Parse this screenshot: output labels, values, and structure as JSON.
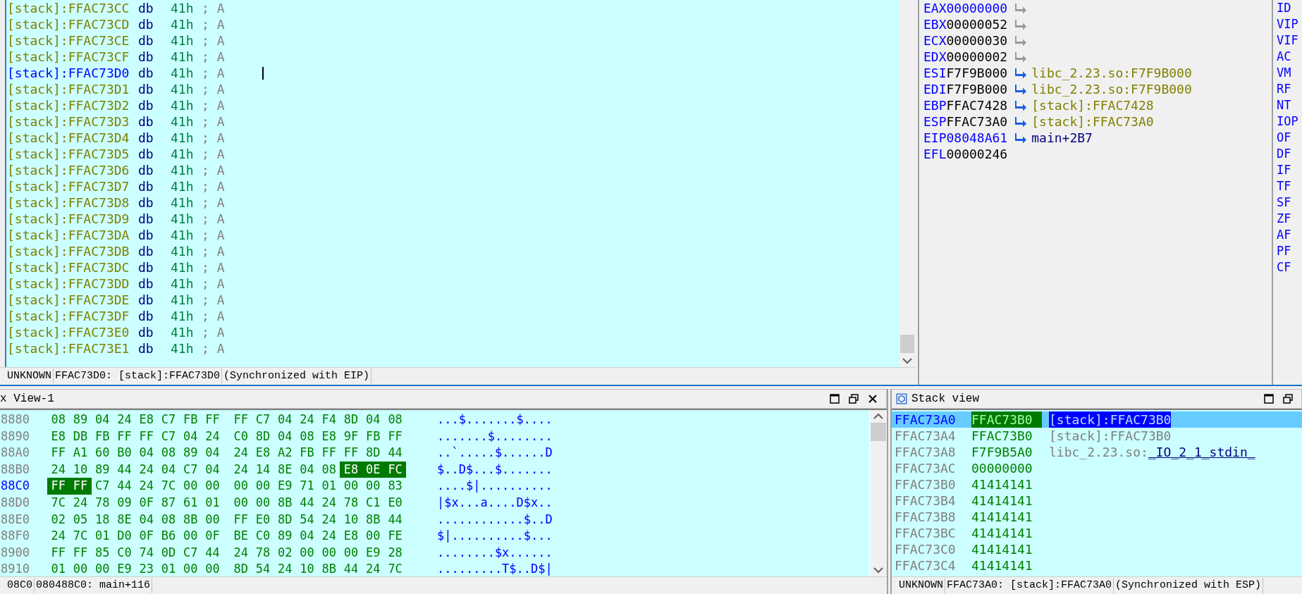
{
  "listing": {
    "rows": [
      {
        "address": "[stack]:FFAC73CC",
        "mnemonic": "db",
        "operand": "41h",
        "comment": "; A",
        "current": false
      },
      {
        "address": "[stack]:FFAC73CD",
        "mnemonic": "db",
        "operand": "41h",
        "comment": "; A",
        "current": false
      },
      {
        "address": "[stack]:FFAC73CE",
        "mnemonic": "db",
        "operand": "41h",
        "comment": "; A",
        "current": false
      },
      {
        "address": "[stack]:FFAC73CF",
        "mnemonic": "db",
        "operand": "41h",
        "comment": "; A",
        "current": false
      },
      {
        "address": "[stack]:FFAC73D0",
        "mnemonic": "db",
        "operand": "41h",
        "comment": "; A",
        "current": true
      },
      {
        "address": "[stack]:FFAC73D1",
        "mnemonic": "db",
        "operand": "41h",
        "comment": "; A",
        "current": false
      },
      {
        "address": "[stack]:FFAC73D2",
        "mnemonic": "db",
        "operand": "41h",
        "comment": "; A",
        "current": false
      },
      {
        "address": "[stack]:FFAC73D3",
        "mnemonic": "db",
        "operand": "41h",
        "comment": "; A",
        "current": false
      },
      {
        "address": "[stack]:FFAC73D4",
        "mnemonic": "db",
        "operand": "41h",
        "comment": "; A",
        "current": false
      },
      {
        "address": "[stack]:FFAC73D5",
        "mnemonic": "db",
        "operand": "41h",
        "comment": "; A",
        "current": false
      },
      {
        "address": "[stack]:FFAC73D6",
        "mnemonic": "db",
        "operand": "41h",
        "comment": "; A",
        "current": false
      },
      {
        "address": "[stack]:FFAC73D7",
        "mnemonic": "db",
        "operand": "41h",
        "comment": "; A",
        "current": false
      },
      {
        "address": "[stack]:FFAC73D8",
        "mnemonic": "db",
        "operand": "41h",
        "comment": "; A",
        "current": false
      },
      {
        "address": "[stack]:FFAC73D9",
        "mnemonic": "db",
        "operand": "41h",
        "comment": "; A",
        "current": false
      },
      {
        "address": "[stack]:FFAC73DA",
        "mnemonic": "db",
        "operand": "41h",
        "comment": "; A",
        "current": false
      },
      {
        "address": "[stack]:FFAC73DB",
        "mnemonic": "db",
        "operand": "41h",
        "comment": "; A",
        "current": false
      },
      {
        "address": "[stack]:FFAC73DC",
        "mnemonic": "db",
        "operand": "41h",
        "comment": "; A",
        "current": false
      },
      {
        "address": "[stack]:FFAC73DD",
        "mnemonic": "db",
        "operand": "41h",
        "comment": "; A",
        "current": false
      },
      {
        "address": "[stack]:FFAC73DE",
        "mnemonic": "db",
        "operand": "41h",
        "comment": "; A",
        "current": false
      },
      {
        "address": "[stack]:FFAC73DF",
        "mnemonic": "db",
        "operand": "41h",
        "comment": "; A",
        "current": false
      },
      {
        "address": "[stack]:FFAC73E0",
        "mnemonic": "db",
        "operand": "41h",
        "comment": "; A",
        "current": false
      },
      {
        "address": "[stack]:FFAC73E1",
        "mnemonic": "db",
        "operand": "41h",
        "comment": "; A",
        "current": false
      }
    ],
    "status": [
      "UNKNOWN",
      "FFAC73D0: [stack]:FFAC73D0",
      "(Synchronized with EIP)"
    ]
  },
  "registers": [
    {
      "name": "EAX",
      "value": "00000000",
      "changed": true,
      "arrow": true,
      "pointer": false
    },
    {
      "name": "EBX",
      "value": "00000052",
      "changed": false,
      "arrow": true,
      "pointer": false
    },
    {
      "name": "ECX",
      "value": "00000030",
      "changed": false,
      "arrow": true,
      "pointer": false
    },
    {
      "name": "EDX",
      "value": "00000002",
      "changed": false,
      "arrow": true,
      "pointer": false
    },
    {
      "name": "ESI",
      "value": "F7F9B000",
      "changed": false,
      "arrow": true,
      "pointer": true,
      "target": {
        "text": "libc_2.23.so:F7F9B000",
        "kind": "data"
      }
    },
    {
      "name": "EDI",
      "value": "F7F9B000",
      "changed": false,
      "arrow": true,
      "pointer": true,
      "target": {
        "text": "libc_2.23.so:F7F9B000",
        "kind": "data"
      }
    },
    {
      "name": "EBP",
      "value": "FFAC7428",
      "changed": false,
      "arrow": true,
      "pointer": true,
      "target": {
        "text": "[stack]:FFAC7428",
        "kind": "data"
      }
    },
    {
      "name": "ESP",
      "value": "FFAC73A0",
      "changed": false,
      "arrow": true,
      "pointer": true,
      "target": {
        "text": "[stack]:FFAC73A0",
        "kind": "data"
      }
    },
    {
      "name": "EIP",
      "value": "08048A61",
      "changed": true,
      "arrow": true,
      "pointer": true,
      "target": {
        "text": "main+2B7",
        "kind": "code"
      }
    },
    {
      "name": "EFL",
      "value": "00000246",
      "changed": false,
      "arrow": false
    }
  ],
  "flags": [
    "ID",
    "VIP",
    "VIF",
    "AC",
    "VM",
    "RF",
    "NT",
    "IOP",
    "OF",
    "DF",
    "IF",
    "TF",
    "SF",
    "ZF",
    "AF",
    "PF",
    "CF"
  ],
  "hex_view": {
    "title": "x View-1",
    "rows": [
      {
        "address": "8880",
        "current": false,
        "ascii": "...$.......$....",
        "bytes": [
          {
            "byte": "08",
            "selected": false
          },
          {
            "byte": "89",
            "selected": false
          },
          {
            "byte": "04",
            "selected": false
          },
          {
            "byte": "24",
            "selected": false
          },
          {
            "byte": "E8",
            "selected": false
          },
          {
            "byte": "C7",
            "selected": false
          },
          {
            "byte": "FB",
            "selected": false
          },
          {
            "byte": "FF",
            "selected": false
          },
          {
            "byte": "FF",
            "selected": false
          },
          {
            "byte": "C7",
            "selected": false
          },
          {
            "byte": "04",
            "selected": false
          },
          {
            "byte": "24",
            "selected": false
          },
          {
            "byte": "F4",
            "selected": false
          },
          {
            "byte": "8D",
            "selected": false
          },
          {
            "byte": "04",
            "selected": false
          },
          {
            "byte": "08",
            "selected": false
          }
        ]
      },
      {
        "address": "8890",
        "current": false,
        "ascii": ".......$........",
        "bytes": [
          {
            "byte": "E8",
            "selected": false
          },
          {
            "byte": "DB",
            "selected": false
          },
          {
            "byte": "FB",
            "selected": false
          },
          {
            "byte": "FF",
            "selected": false
          },
          {
            "byte": "FF",
            "selected": false
          },
          {
            "byte": "C7",
            "selected": false
          },
          {
            "byte": "04",
            "selected": false
          },
          {
            "byte": "24",
            "selected": false
          },
          {
            "byte": "C0",
            "selected": false
          },
          {
            "byte": "8D",
            "selected": false
          },
          {
            "byte": "04",
            "selected": false
          },
          {
            "byte": "08",
            "selected": false
          },
          {
            "byte": "E8",
            "selected": false
          },
          {
            "byte": "9F",
            "selected": false
          },
          {
            "byte": "FB",
            "selected": false
          },
          {
            "byte": "FF",
            "selected": false
          }
        ]
      },
      {
        "address": "88A0",
        "current": false,
        "ascii": "..`.....$......D",
        "bytes": [
          {
            "byte": "FF",
            "selected": false
          },
          {
            "byte": "A1",
            "selected": false
          },
          {
            "byte": "60",
            "selected": false
          },
          {
            "byte": "B0",
            "selected": false
          },
          {
            "byte": "04",
            "selected": false
          },
          {
            "byte": "08",
            "selected": false
          },
          {
            "byte": "89",
            "selected": false
          },
          {
            "byte": "04",
            "selected": false
          },
          {
            "byte": "24",
            "selected": false
          },
          {
            "byte": "E8",
            "selected": false
          },
          {
            "byte": "A2",
            "selected": false
          },
          {
            "byte": "FB",
            "selected": false
          },
          {
            "byte": "FF",
            "selected": false
          },
          {
            "byte": "FF",
            "selected": false
          },
          {
            "byte": "8D",
            "selected": false
          },
          {
            "byte": "44",
            "selected": false
          }
        ]
      },
      {
        "address": "88B0",
        "current": false,
        "ascii": "$..D$...$.......",
        "bytes": [
          {
            "byte": "24",
            "selected": false
          },
          {
            "byte": "10",
            "selected": false
          },
          {
            "byte": "89",
            "selected": false
          },
          {
            "byte": "44",
            "selected": false
          },
          {
            "byte": "24",
            "selected": false
          },
          {
            "byte": "04",
            "selected": false
          },
          {
            "byte": "C7",
            "selected": false
          },
          {
            "byte": "04",
            "selected": false
          },
          {
            "byte": "24",
            "selected": false
          },
          {
            "byte": "14",
            "selected": false
          },
          {
            "byte": "8E",
            "selected": false
          },
          {
            "byte": "04",
            "selected": false
          },
          {
            "byte": "08",
            "selected": false
          },
          {
            "byte": "E8",
            "selected": true
          },
          {
            "byte": "0E",
            "selected": true
          },
          {
            "byte": "FC",
            "selected": true
          }
        ]
      },
      {
        "address": "88C0",
        "current": true,
        "ascii": "....$|..........",
        "bytes": [
          {
            "byte": "FF",
            "selected": true
          },
          {
            "byte": "FF",
            "selected": true
          },
          {
            "byte": "C7",
            "selected": false
          },
          {
            "byte": "44",
            "selected": false
          },
          {
            "byte": "24",
            "selected": false
          },
          {
            "byte": "7C",
            "selected": false
          },
          {
            "byte": "00",
            "selected": false
          },
          {
            "byte": "00",
            "selected": false
          },
          {
            "byte": "00",
            "selected": false
          },
          {
            "byte": "00",
            "selected": false
          },
          {
            "byte": "E9",
            "selected": false
          },
          {
            "byte": "71",
            "selected": false
          },
          {
            "byte": "01",
            "selected": false
          },
          {
            "byte": "00",
            "selected": false
          },
          {
            "byte": "00",
            "selected": false
          },
          {
            "byte": "83",
            "selected": false
          }
        ]
      },
      {
        "address": "88D0",
        "current": false,
        "ascii": "|$x...a....D$x..",
        "bytes": [
          {
            "byte": "7C",
            "selected": false
          },
          {
            "byte": "24",
            "selected": false
          },
          {
            "byte": "78",
            "selected": false
          },
          {
            "byte": "09",
            "selected": false
          },
          {
            "byte": "0F",
            "selected": false
          },
          {
            "byte": "87",
            "selected": false
          },
          {
            "byte": "61",
            "selected": false
          },
          {
            "byte": "01",
            "selected": false
          },
          {
            "byte": "00",
            "selected": false
          },
          {
            "byte": "00",
            "selected": false
          },
          {
            "byte": "8B",
            "selected": false
          },
          {
            "byte": "44",
            "selected": false
          },
          {
            "byte": "24",
            "selected": false
          },
          {
            "byte": "78",
            "selected": false
          },
          {
            "byte": "C1",
            "selected": false
          },
          {
            "byte": "E0",
            "selected": false
          }
        ]
      },
      {
        "address": "88E0",
        "current": false,
        "ascii": "............$..D",
        "bytes": [
          {
            "byte": "02",
            "selected": false
          },
          {
            "byte": "05",
            "selected": false
          },
          {
            "byte": "18",
            "selected": false
          },
          {
            "byte": "8E",
            "selected": false
          },
          {
            "byte": "04",
            "selected": false
          },
          {
            "byte": "08",
            "selected": false
          },
          {
            "byte": "8B",
            "selected": false
          },
          {
            "byte": "00",
            "selected": false
          },
          {
            "byte": "FF",
            "selected": false
          },
          {
            "byte": "E0",
            "selected": false
          },
          {
            "byte": "8D",
            "selected": false
          },
          {
            "byte": "54",
            "selected": false
          },
          {
            "byte": "24",
            "selected": false
          },
          {
            "byte": "10",
            "selected": false
          },
          {
            "byte": "8B",
            "selected": false
          },
          {
            "byte": "44",
            "selected": false
          }
        ]
      },
      {
        "address": "88F0",
        "current": false,
        "ascii": "$|..........$...",
        "bytes": [
          {
            "byte": "24",
            "selected": false
          },
          {
            "byte": "7C",
            "selected": false
          },
          {
            "byte": "01",
            "selected": false
          },
          {
            "byte": "D0",
            "selected": false
          },
          {
            "byte": "0F",
            "selected": false
          },
          {
            "byte": "B6",
            "selected": false
          },
          {
            "byte": "00",
            "selected": false
          },
          {
            "byte": "0F",
            "selected": false
          },
          {
            "byte": "BE",
            "selected": false
          },
          {
            "byte": "C0",
            "selected": false
          },
          {
            "byte": "89",
            "selected": false
          },
          {
            "byte": "04",
            "selected": false
          },
          {
            "byte": "24",
            "selected": false
          },
          {
            "byte": "E8",
            "selected": false
          },
          {
            "byte": "00",
            "selected": false
          },
          {
            "byte": "FE",
            "selected": false
          }
        ]
      },
      {
        "address": "8900",
        "current": false,
        "ascii": "........$x......",
        "bytes": [
          {
            "byte": "FF",
            "selected": false
          },
          {
            "byte": "FF",
            "selected": false
          },
          {
            "byte": "85",
            "selected": false
          },
          {
            "byte": "C0",
            "selected": false
          },
          {
            "byte": "74",
            "selected": false
          },
          {
            "byte": "0D",
            "selected": false
          },
          {
            "byte": "C7",
            "selected": false
          },
          {
            "byte": "44",
            "selected": false
          },
          {
            "byte": "24",
            "selected": false
          },
          {
            "byte": "78",
            "selected": false
          },
          {
            "byte": "02",
            "selected": false
          },
          {
            "byte": "00",
            "selected": false
          },
          {
            "byte": "00",
            "selected": false
          },
          {
            "byte": "00",
            "selected": false
          },
          {
            "byte": "E9",
            "selected": false
          },
          {
            "byte": "28",
            "selected": false
          }
        ]
      },
      {
        "address": "8910",
        "current": false,
        "ascii": ".........T$..D$|",
        "bytes": [
          {
            "byte": "01",
            "selected": false
          },
          {
            "byte": "00",
            "selected": false
          },
          {
            "byte": "00",
            "selected": false
          },
          {
            "byte": "E9",
            "selected": false
          },
          {
            "byte": "23",
            "selected": false
          },
          {
            "byte": "01",
            "selected": false
          },
          {
            "byte": "00",
            "selected": false
          },
          {
            "byte": "00",
            "selected": false
          },
          {
            "byte": "8D",
            "selected": false
          },
          {
            "byte": "54",
            "selected": false
          },
          {
            "byte": "24",
            "selected": false
          },
          {
            "byte": "10",
            "selected": false
          },
          {
            "byte": "8B",
            "selected": false
          },
          {
            "byte": "44",
            "selected": false
          },
          {
            "byte": "24",
            "selected": false
          },
          {
            "byte": "7C",
            "selected": false
          }
        ]
      }
    ],
    "status": [
      "08C0",
      "080488C0: main+116"
    ]
  },
  "stack_view": {
    "title": "Stack view",
    "rows": [
      {
        "address": "FFAC73A0",
        "value": "FFAC73B0",
        "comment": "[stack]:FFAC73B0",
        "selected": true
      },
      {
        "address": "FFAC73A4",
        "value": "FFAC73B0",
        "comment": "[stack]:FFAC73B0",
        "selected": false
      },
      {
        "address": "FFAC73A8",
        "value": "F7F9B5A0",
        "comment": "libc_2.23.so:",
        "symbol": "_IO_2_1_stdin_",
        "selected": false
      },
      {
        "address": "FFAC73AC",
        "value": "00000000",
        "selected": false
      },
      {
        "address": "FFAC73B0",
        "value": "41414141",
        "selected": false
      },
      {
        "address": "FFAC73B4",
        "value": "41414141",
        "selected": false
      },
      {
        "address": "FFAC73B8",
        "value": "41414141",
        "selected": false
      },
      {
        "address": "FFAC73BC",
        "value": "41414141",
        "selected": false
      },
      {
        "address": "FFAC73C0",
        "value": "41414141",
        "selected": false
      },
      {
        "address": "FFAC73C4",
        "value": "41414141",
        "selected": false
      }
    ],
    "status": [
      "UNKNOWN",
      "FFAC73A0: [stack]:FFAC73A0",
      "(Synchronized with ESP)"
    ]
  }
}
